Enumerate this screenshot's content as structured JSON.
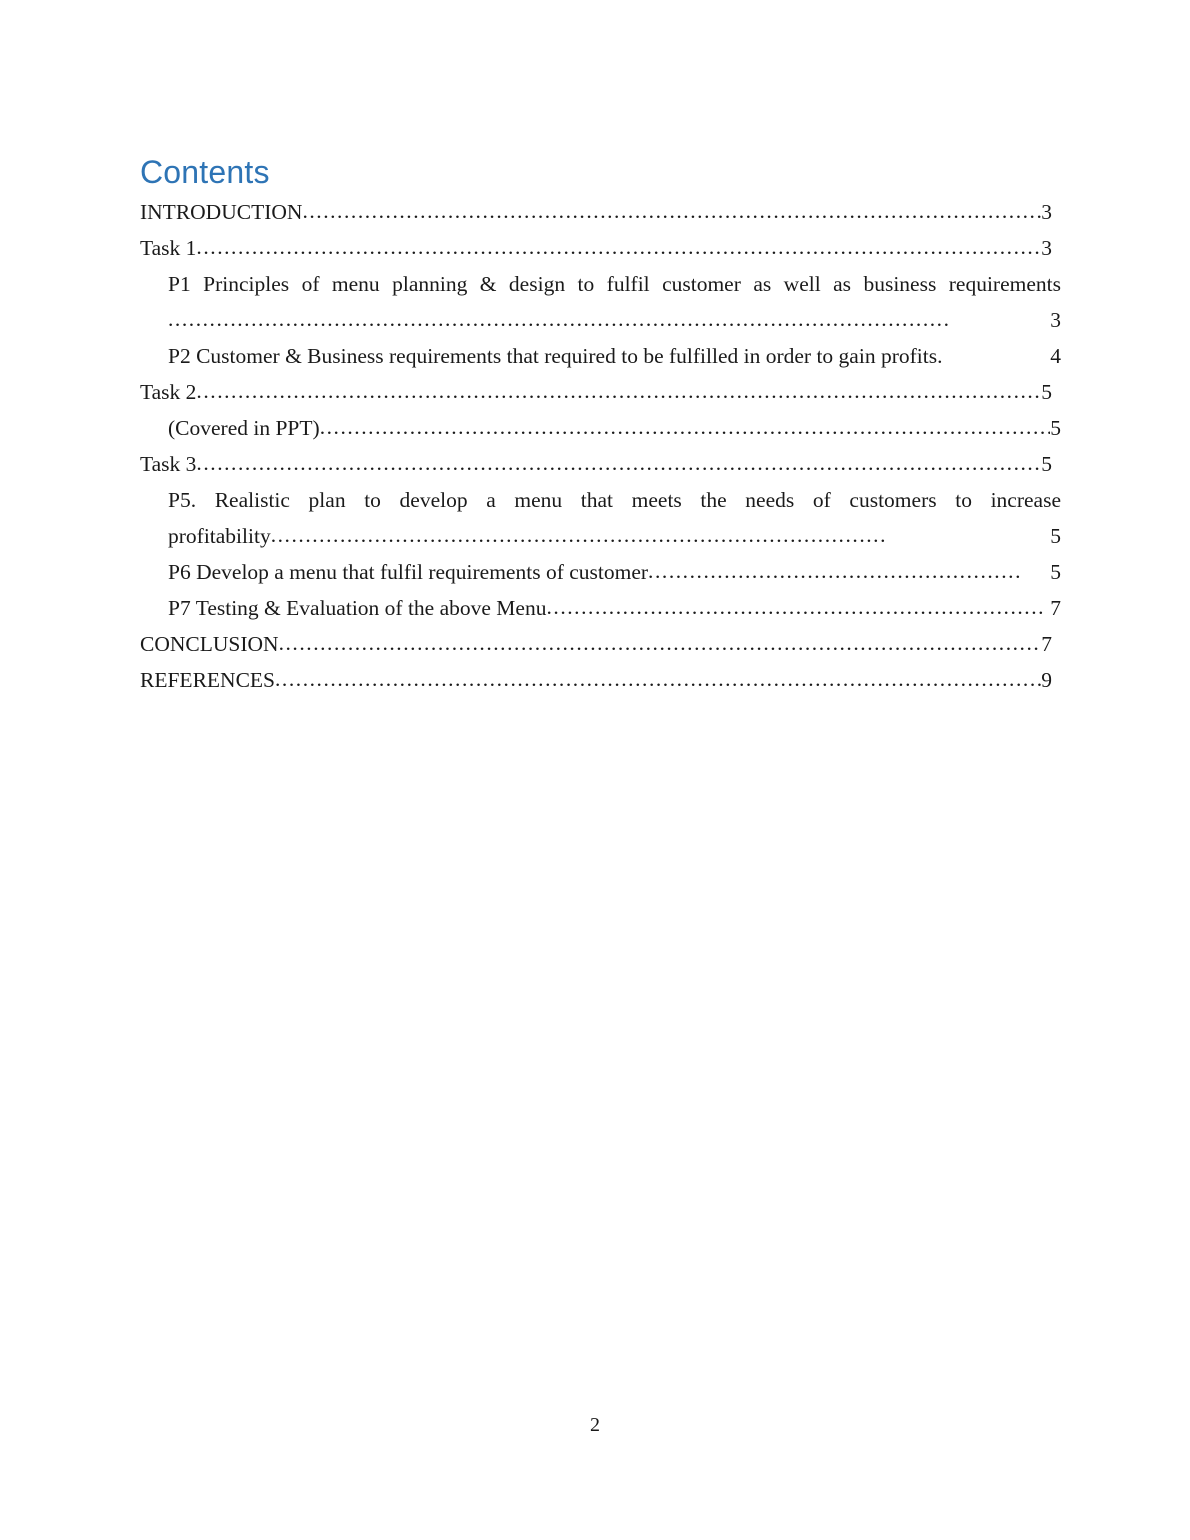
{
  "document": {
    "heading": "Contents",
    "heading_color": "#2E74B5",
    "footer_page_number": "2"
  },
  "toc": {
    "entries": [
      {
        "level": 1,
        "label": "INTRODUCTION",
        "page": "3",
        "wrapped": false,
        "leader": "........................................................................................................................."
      },
      {
        "level": 1,
        "label": "Task 1",
        "page": "3",
        "wrapped": false,
        "leader": "..............................................................................................................................................."
      },
      {
        "level": 2,
        "label": "P1 Principles of menu planning & design to fulfil customer as well as business requirements",
        "page": "3",
        "wrapped": true,
        "wrap_first_line": "P1 Principles of menu planning & design to fulfil customer as well as business requirements",
        "wrap_second_line": "",
        "leader": "................................................................................................................."
      },
      {
        "level": 2,
        "label": "P2 Customer & Business requirements that required to be fulfilled in order to gain profits.",
        "page": "4",
        "wrapped": false,
        "leader": " "
      },
      {
        "level": 1,
        "label": "Task 2",
        "page": "5",
        "wrapped": false,
        "leader": "..............................................................................................................................................."
      },
      {
        "level": 2,
        "label": "(Covered in PPT)",
        "page": "5",
        "wrapped": false,
        "leader": "................................................................................................................."
      },
      {
        "level": 1,
        "label": "Task 3",
        "page": "5",
        "wrapped": false,
        "leader": "..............................................................................................................................................."
      },
      {
        "level": 2,
        "label": "P5. Realistic plan to develop a menu that meets the needs of customers to increase profitability",
        "page": "5",
        "wrapped": true,
        "wrap_first_line": "P5. Realistic plan to develop a menu that meets the needs of customers to increase",
        "wrap_second_line": "profitability",
        "leader": "........................................................................................."
      },
      {
        "level": 2,
        "label": "P6 Develop a menu that fulfil requirements of customer",
        "page": "5",
        "wrapped": false,
        "leader": "......................................................"
      },
      {
        "level": 2,
        "label": "P7 Testing & Evaluation of the above Menu",
        "page": "7",
        "wrapped": false,
        "leader": "........................................................................"
      },
      {
        "level": 1,
        "label": "CONCLUSION",
        "page": "7",
        "wrapped": false,
        "leader": "............................................................................................................................."
      },
      {
        "level": 1,
        "label": "REFERENCES",
        "page": "9",
        "wrapped": false,
        "leader": "............................................................................................................................."
      }
    ]
  }
}
